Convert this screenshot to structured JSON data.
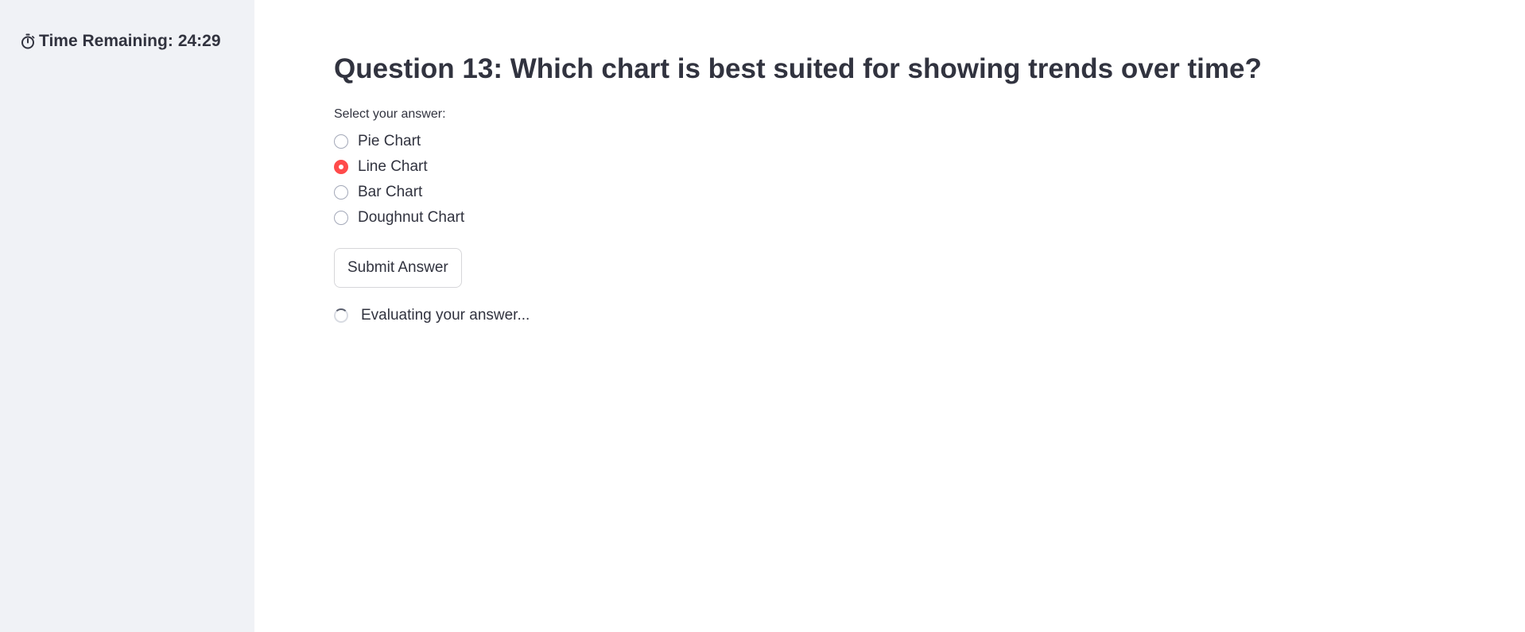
{
  "sidebar": {
    "timer": {
      "icon": "stopwatch-icon",
      "label": "Time Remaining:",
      "value": "24:29"
    }
  },
  "question": {
    "title": "Question 13: Which chart is best suited for showing trends over time?",
    "prompt": "Select your answer:",
    "options": [
      {
        "label": "Pie Chart",
        "selected": false
      },
      {
        "label": "Line Chart",
        "selected": true
      },
      {
        "label": "Bar Chart",
        "selected": false
      },
      {
        "label": "Doughnut Chart",
        "selected": false
      }
    ],
    "selected_value": "Line Chart"
  },
  "actions": {
    "submit_label": "Submit Answer"
  },
  "status": {
    "icon": "spinner-icon",
    "text": "Evaluating your answer..."
  },
  "colors": {
    "accent": "#ff4b4b",
    "sidebar_bg": "#f0f2f6",
    "text": "#31333f"
  }
}
